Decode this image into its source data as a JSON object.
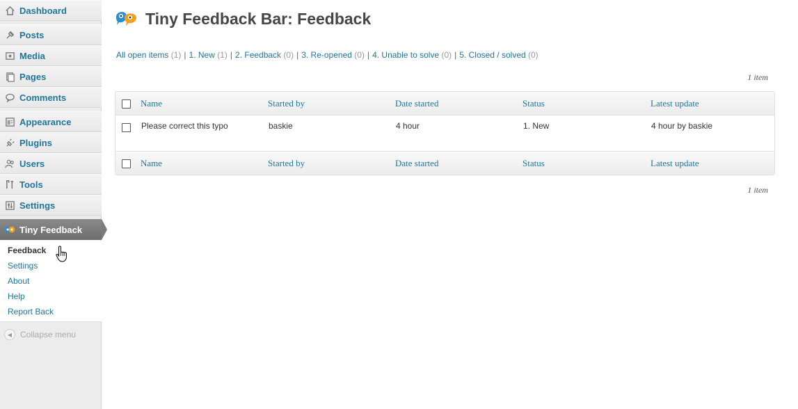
{
  "sidebar": {
    "items": [
      {
        "label": "Dashboard",
        "icon": "home-icon"
      },
      {
        "label": "Posts",
        "icon": "pin-icon"
      },
      {
        "label": "Media",
        "icon": "media-icon"
      },
      {
        "label": "Pages",
        "icon": "pages-icon"
      },
      {
        "label": "Comments",
        "icon": "comments-icon"
      },
      {
        "label": "Appearance",
        "icon": "appearance-icon"
      },
      {
        "label": "Plugins",
        "icon": "plugins-icon"
      },
      {
        "label": "Users",
        "icon": "users-icon"
      },
      {
        "label": "Tools",
        "icon": "tools-icon"
      },
      {
        "label": "Settings",
        "icon": "settings-icon"
      }
    ],
    "active": {
      "label": "Tiny Feedback",
      "icon": "tiny-feedback-icon"
    },
    "submenu": [
      "Feedback",
      "Settings",
      "About",
      "Help",
      "Report Back"
    ],
    "collapse_label": "Collapse menu"
  },
  "header": {
    "title": "Tiny Feedback Bar: Feedback",
    "icon": "tiny-feedback-logo-icon"
  },
  "filters": [
    {
      "label": "All open items",
      "count": "(1)"
    },
    {
      "label": "1. New",
      "count": "(1)"
    },
    {
      "label": "2. Feedback",
      "count": "(0)"
    },
    {
      "label": "3. Re-opened",
      "count": "(0)"
    },
    {
      "label": "4. Unable to solve",
      "count": "(0)"
    },
    {
      "label": "5. Closed / solved",
      "count": "(0)"
    }
  ],
  "item_count_label": "1 item",
  "table": {
    "columns": [
      "Name",
      "Started by",
      "Date started",
      "Status",
      "Latest update"
    ],
    "rows": [
      {
        "name": "Please correct this typo",
        "started_by": "baskie",
        "date_started": "4 hour",
        "status": "1. New",
        "latest_update": "4 hour by baskie"
      }
    ]
  },
  "colors": {
    "link": "#21759b",
    "active_menu": "#7b7b7b"
  }
}
